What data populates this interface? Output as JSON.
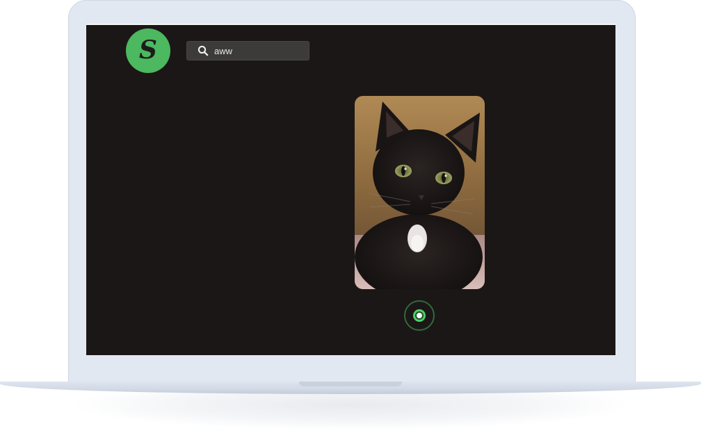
{
  "app": {
    "logo": {
      "glyph": "S",
      "icon": "logo-s-icon",
      "color": "#4cb85f"
    },
    "search": {
      "icon": "search-icon",
      "value": "aww",
      "placeholder": ""
    },
    "photo": {
      "subject": "cat-photo",
      "icon": "cat-image"
    },
    "record_button": {
      "icon": "record-icon",
      "accent": "#4cd06a"
    }
  },
  "colors": {
    "screen_background": "#1b1717",
    "search_background": "#3d3a3a",
    "device_frame": "#e2e8f1"
  }
}
